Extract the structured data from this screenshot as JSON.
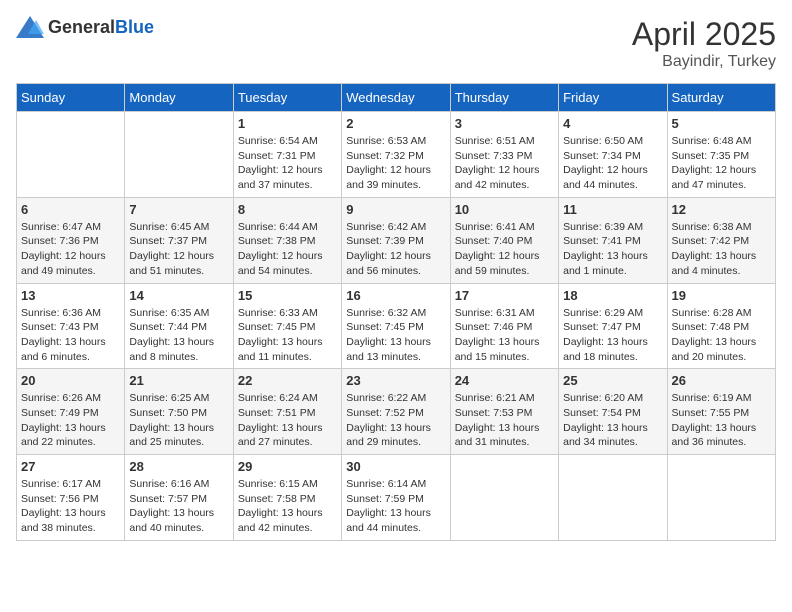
{
  "header": {
    "logo_general": "General",
    "logo_blue": "Blue",
    "title": "April 2025",
    "location": "Bayindir, Turkey"
  },
  "calendar": {
    "days_of_week": [
      "Sunday",
      "Monday",
      "Tuesday",
      "Wednesday",
      "Thursday",
      "Friday",
      "Saturday"
    ],
    "weeks": [
      [
        {
          "day": "",
          "info": ""
        },
        {
          "day": "",
          "info": ""
        },
        {
          "day": "1",
          "info": "Sunrise: 6:54 AM\nSunset: 7:31 PM\nDaylight: 12 hours and 37 minutes."
        },
        {
          "day": "2",
          "info": "Sunrise: 6:53 AM\nSunset: 7:32 PM\nDaylight: 12 hours and 39 minutes."
        },
        {
          "day": "3",
          "info": "Sunrise: 6:51 AM\nSunset: 7:33 PM\nDaylight: 12 hours and 42 minutes."
        },
        {
          "day": "4",
          "info": "Sunrise: 6:50 AM\nSunset: 7:34 PM\nDaylight: 12 hours and 44 minutes."
        },
        {
          "day": "5",
          "info": "Sunrise: 6:48 AM\nSunset: 7:35 PM\nDaylight: 12 hours and 47 minutes."
        }
      ],
      [
        {
          "day": "6",
          "info": "Sunrise: 6:47 AM\nSunset: 7:36 PM\nDaylight: 12 hours and 49 minutes."
        },
        {
          "day": "7",
          "info": "Sunrise: 6:45 AM\nSunset: 7:37 PM\nDaylight: 12 hours and 51 minutes."
        },
        {
          "day": "8",
          "info": "Sunrise: 6:44 AM\nSunset: 7:38 PM\nDaylight: 12 hours and 54 minutes."
        },
        {
          "day": "9",
          "info": "Sunrise: 6:42 AM\nSunset: 7:39 PM\nDaylight: 12 hours and 56 minutes."
        },
        {
          "day": "10",
          "info": "Sunrise: 6:41 AM\nSunset: 7:40 PM\nDaylight: 12 hours and 59 minutes."
        },
        {
          "day": "11",
          "info": "Sunrise: 6:39 AM\nSunset: 7:41 PM\nDaylight: 13 hours and 1 minute."
        },
        {
          "day": "12",
          "info": "Sunrise: 6:38 AM\nSunset: 7:42 PM\nDaylight: 13 hours and 4 minutes."
        }
      ],
      [
        {
          "day": "13",
          "info": "Sunrise: 6:36 AM\nSunset: 7:43 PM\nDaylight: 13 hours and 6 minutes."
        },
        {
          "day": "14",
          "info": "Sunrise: 6:35 AM\nSunset: 7:44 PM\nDaylight: 13 hours and 8 minutes."
        },
        {
          "day": "15",
          "info": "Sunrise: 6:33 AM\nSunset: 7:45 PM\nDaylight: 13 hours and 11 minutes."
        },
        {
          "day": "16",
          "info": "Sunrise: 6:32 AM\nSunset: 7:45 PM\nDaylight: 13 hours and 13 minutes."
        },
        {
          "day": "17",
          "info": "Sunrise: 6:31 AM\nSunset: 7:46 PM\nDaylight: 13 hours and 15 minutes."
        },
        {
          "day": "18",
          "info": "Sunrise: 6:29 AM\nSunset: 7:47 PM\nDaylight: 13 hours and 18 minutes."
        },
        {
          "day": "19",
          "info": "Sunrise: 6:28 AM\nSunset: 7:48 PM\nDaylight: 13 hours and 20 minutes."
        }
      ],
      [
        {
          "day": "20",
          "info": "Sunrise: 6:26 AM\nSunset: 7:49 PM\nDaylight: 13 hours and 22 minutes."
        },
        {
          "day": "21",
          "info": "Sunrise: 6:25 AM\nSunset: 7:50 PM\nDaylight: 13 hours and 25 minutes."
        },
        {
          "day": "22",
          "info": "Sunrise: 6:24 AM\nSunset: 7:51 PM\nDaylight: 13 hours and 27 minutes."
        },
        {
          "day": "23",
          "info": "Sunrise: 6:22 AM\nSunset: 7:52 PM\nDaylight: 13 hours and 29 minutes."
        },
        {
          "day": "24",
          "info": "Sunrise: 6:21 AM\nSunset: 7:53 PM\nDaylight: 13 hours and 31 minutes."
        },
        {
          "day": "25",
          "info": "Sunrise: 6:20 AM\nSunset: 7:54 PM\nDaylight: 13 hours and 34 minutes."
        },
        {
          "day": "26",
          "info": "Sunrise: 6:19 AM\nSunset: 7:55 PM\nDaylight: 13 hours and 36 minutes."
        }
      ],
      [
        {
          "day": "27",
          "info": "Sunrise: 6:17 AM\nSunset: 7:56 PM\nDaylight: 13 hours and 38 minutes."
        },
        {
          "day": "28",
          "info": "Sunrise: 6:16 AM\nSunset: 7:57 PM\nDaylight: 13 hours and 40 minutes."
        },
        {
          "day": "29",
          "info": "Sunrise: 6:15 AM\nSunset: 7:58 PM\nDaylight: 13 hours and 42 minutes."
        },
        {
          "day": "30",
          "info": "Sunrise: 6:14 AM\nSunset: 7:59 PM\nDaylight: 13 hours and 44 minutes."
        },
        {
          "day": "",
          "info": ""
        },
        {
          "day": "",
          "info": ""
        },
        {
          "day": "",
          "info": ""
        }
      ]
    ]
  }
}
